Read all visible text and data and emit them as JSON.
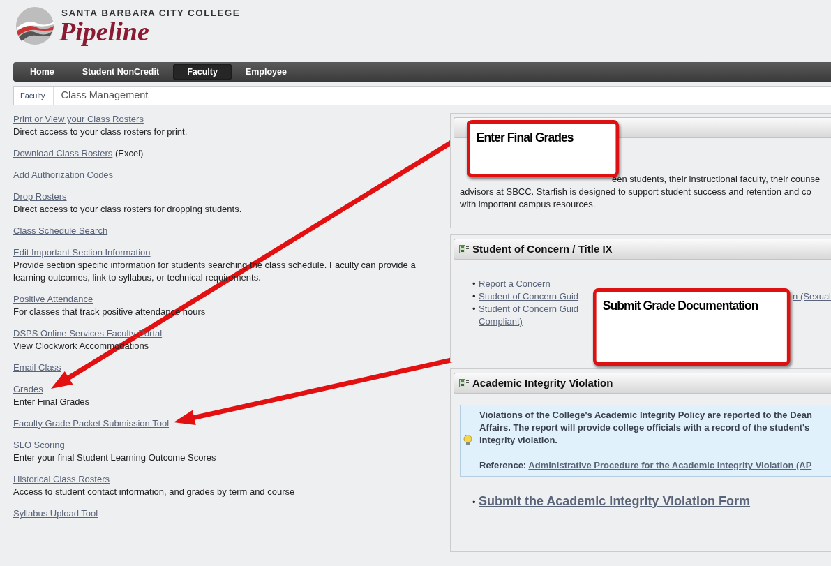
{
  "logo": {
    "college": "SANTA BARBARA CITY COLLEGE",
    "title": "Pipeline"
  },
  "nav_tabs": [
    {
      "label": "Home",
      "selected": false
    },
    {
      "label": "Student NonCredit",
      "selected": false
    },
    {
      "label": "Faculty",
      "selected": true
    },
    {
      "label": "Employee",
      "selected": false
    }
  ],
  "breadcrumb": {
    "parent": "Faculty",
    "current": "Class Management"
  },
  "links": [
    {
      "label": "Print or View your Class Rosters",
      "description": "Direct access to your class rosters for print."
    },
    {
      "label": "Download Class Rosters",
      "suffix": "(Excel)"
    },
    {
      "label": "Add Authorization Codes"
    },
    {
      "label": "Drop Rosters",
      "description": "Direct access to your class rosters for dropping students."
    },
    {
      "label": "Class Schedule Search"
    },
    {
      "label": "Edit Important Section Information",
      "description": "Provide section specific information for students searching the class schedule. Faculty can provide a learning outcomes, link to syllabus, or technical requirements."
    },
    {
      "label": "Positive Attendance",
      "description": "For classes that track positive attendance hours"
    },
    {
      "label": "DSPS Online Services Faculty Portal",
      "description": "View Clockwork Accommodations"
    },
    {
      "label": "Email Class"
    },
    {
      "label": "Grades",
      "description": "Enter Final Grades"
    },
    {
      "label": "Faculty Grade Packet Submission Tool"
    },
    {
      "label": "SLO Scoring",
      "description": "Enter your final Student Learning Outcome Scores"
    },
    {
      "label": "Historical Class Rosters",
      "description": "Access to student contact information, and grades by term and course"
    },
    {
      "label": "Syllabus Upload Tool"
    }
  ],
  "panels": [
    {
      "kind": "text",
      "lines": [
        {
          "text": "een students, their instructional faculty, their counse",
          "covered_start": true
        },
        {
          "text": "advisors at SBCC. Starfish is designed to support student success and retention and co",
          "covered_start": false
        },
        {
          "text": "with important campus resources.",
          "covered_start": false
        }
      ]
    },
    {
      "kind": "list",
      "title": "Student of Concern / Title IX",
      "items": [
        {
          "bullet": "•",
          "parts": [
            "Report a Concern"
          ]
        },
        {
          "bullet": "•",
          "parts": [
            "Student of Concern Guid",
            "n (Sexual"
          ]
        },
        {
          "bullet": "•",
          "parts": [
            "Student of Concern Guid"
          ],
          "continuation": "Compliant)"
        }
      ]
    },
    {
      "kind": "info",
      "title": "Academic Integrity Violation",
      "info_lines": [
        "Violations of the College's Academic Integrity Policy are reported to the Dean",
        "Affairs. The report will provide college officials with a record of the student's",
        "integrity violation."
      ],
      "reference_label": "Reference:",
      "reference_link": "Administrative Procedure for the Academic Integrity Violation (AP",
      "action_bullet": "•",
      "action_link": "Submit the Academic Integrity Violation Form"
    }
  ],
  "callouts": [
    {
      "text": "Enter Final Grades"
    },
    {
      "text": "Submit Grade Documentation"
    }
  ]
}
